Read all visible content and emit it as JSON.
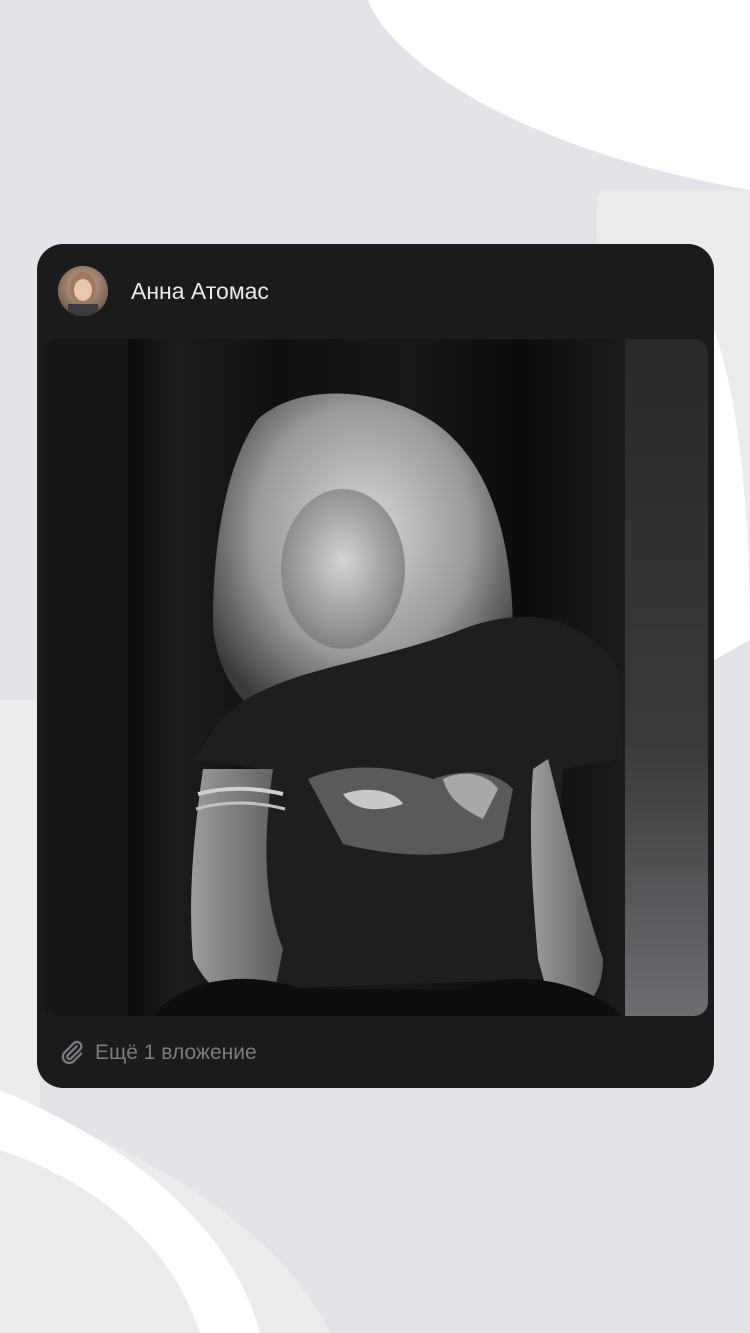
{
  "post": {
    "author_name": "Анна Атомас",
    "avatar_icon": "user-avatar-photo",
    "photo_description_icon": "photo",
    "more_attachments_label": "Ещё 1 вложение",
    "attachment_icon": "paperclip-icon"
  },
  "colors": {
    "page_background": "#e3e4e9",
    "card_background": "#1b1b1d",
    "author_text": "#e9e9ec",
    "secondary_text": "#7b7c81"
  }
}
